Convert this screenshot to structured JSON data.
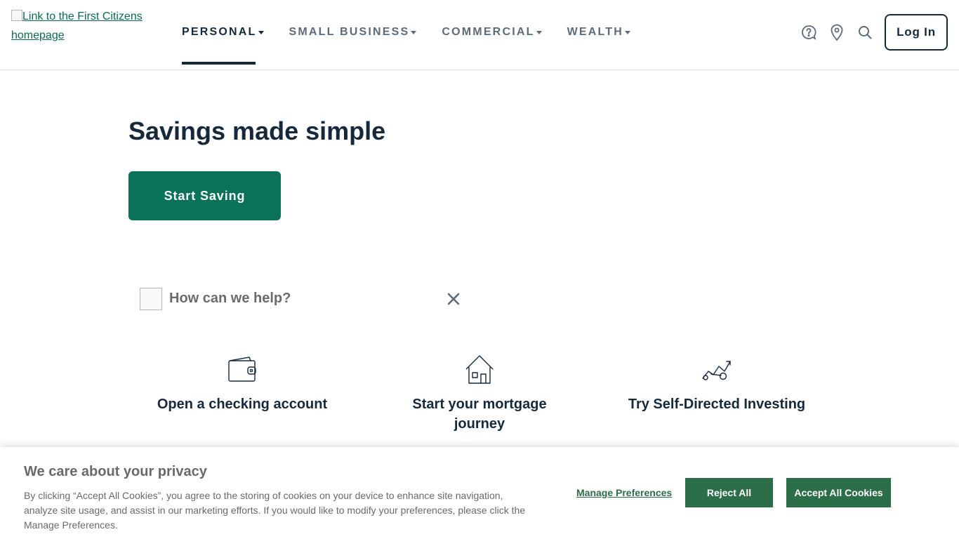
{
  "header": {
    "logo_alt": "Link to the First Citizens homepage",
    "nav": [
      {
        "label": "PERSONAL",
        "active": true
      },
      {
        "label": "SMALL BUSINESS",
        "active": false
      },
      {
        "label": "COMMERCIAL",
        "active": false
      },
      {
        "label": "WEALTH",
        "active": false
      }
    ],
    "icons": [
      "help-icon",
      "location-icon",
      "search-icon"
    ],
    "login_label": "Log In"
  },
  "hero": {
    "title": "Savings made simple",
    "cta_label": "Start Saving"
  },
  "help": {
    "prompt": "How can we help?",
    "tiles": [
      {
        "label": "Open a checking account",
        "icon": "wallet-icon"
      },
      {
        "label": "Start your mortgage journey",
        "icon": "house-icon"
      },
      {
        "label": "Try Self-Directed Investing",
        "icon": "investing-icon"
      }
    ]
  },
  "cookie": {
    "title": "We care about your privacy",
    "text": "By clicking “Accept All Cookies”, you agree to the storing of cookies on your device to enhance site navigation, analyze site usage, and assist in our marketing efforts. If you would like to modify your preferences, please click the Manage Preferences.",
    "manage_label": "Manage Preferences",
    "reject_label": "Reject All",
    "accept_label": "Accept All Cookies"
  },
  "colors": {
    "navy": "#16293a",
    "brand_green": "#0a7258",
    "cookie_green": "#2c6e47",
    "muted_gray": "#5d6b78"
  }
}
